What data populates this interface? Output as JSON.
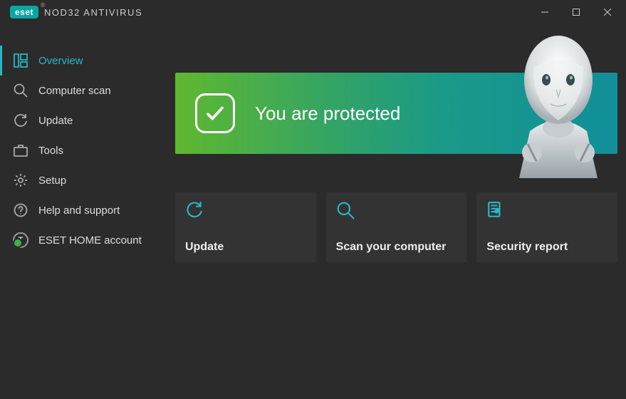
{
  "brand": {
    "badge": "eset",
    "product": "NOD32 ANTIVIRUS"
  },
  "sidebar": {
    "items": [
      {
        "label": "Overview"
      },
      {
        "label": "Computer scan"
      },
      {
        "label": "Update"
      },
      {
        "label": "Tools"
      },
      {
        "label": "Setup"
      },
      {
        "label": "Help and support"
      },
      {
        "label": "ESET HOME account"
      }
    ]
  },
  "status": {
    "message": "You are protected"
  },
  "cards": [
    {
      "label": "Update"
    },
    {
      "label": "Scan your computer"
    },
    {
      "label": "Security report"
    }
  ]
}
